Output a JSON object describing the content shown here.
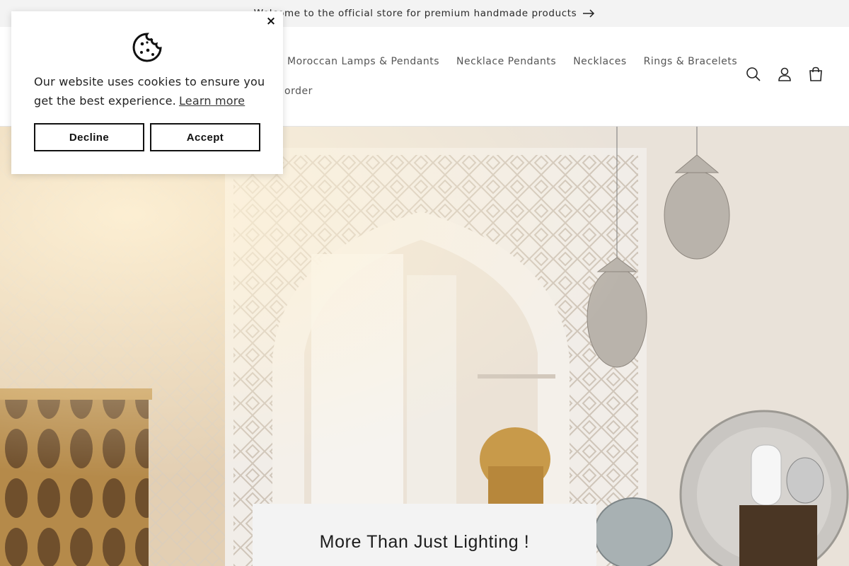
{
  "announcement": {
    "text": "Welcome to the official store for premium handmade products"
  },
  "nav": {
    "row1": [
      "Moroccan Lamps & Pendants",
      "Necklace Pendants",
      "Necklaces",
      "Rings & Bracelets"
    ],
    "row2": [
      "order"
    ]
  },
  "header_icons": [
    "search-icon",
    "account-icon",
    "cart-icon"
  ],
  "hero": {
    "heading": "More Than Just Lighting !"
  },
  "cookie_banner": {
    "message": "Our website uses cookies to ensure you get the best experience.",
    "learn_more": "Learn more",
    "decline_label": "Decline",
    "accept_label": "Accept",
    "close_label": "×"
  },
  "colors": {
    "announcement_bg": "#f3f3f3",
    "hero_card_bg": "#f3f3f3",
    "button_border": "#111111"
  }
}
